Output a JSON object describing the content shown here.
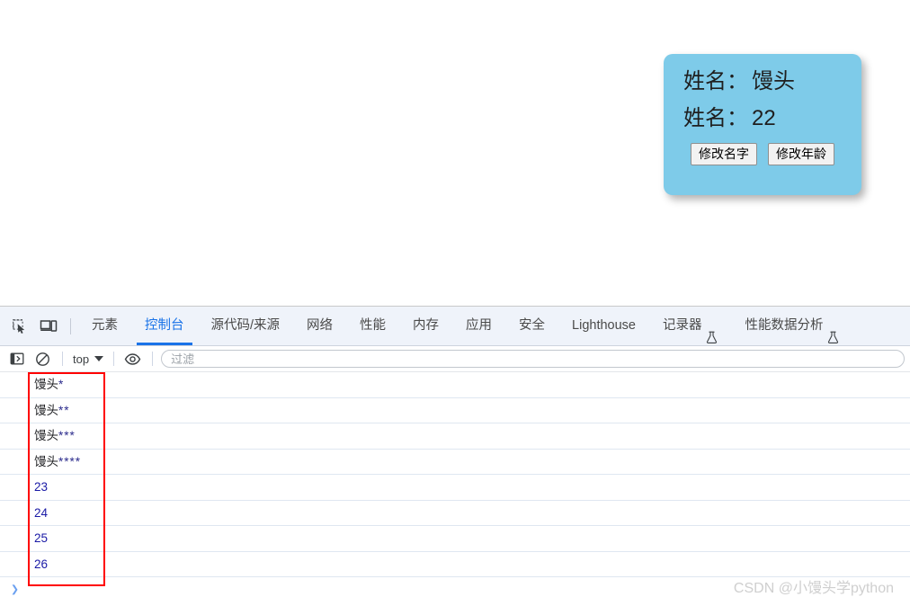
{
  "page": {
    "card": {
      "name_row": {
        "label": "姓名：",
        "value": "馒头"
      },
      "age_row": {
        "label": "姓名：",
        "value": "22"
      },
      "buttons": {
        "change_name": "修改名字",
        "change_age": "修改年龄"
      },
      "background_color": "#7ecbe9"
    }
  },
  "devtools": {
    "toolbar_icons": {
      "inspect": "inspect-element-icon",
      "device": "device-toolbar-icon"
    },
    "tabs": [
      {
        "label": "元素",
        "active": false,
        "experimental": false
      },
      {
        "label": "控制台",
        "active": true,
        "experimental": false
      },
      {
        "label": "源代码/来源",
        "active": false,
        "experimental": false
      },
      {
        "label": "网络",
        "active": false,
        "experimental": false
      },
      {
        "label": "性能",
        "active": false,
        "experimental": false
      },
      {
        "label": "内存",
        "active": false,
        "experimental": false
      },
      {
        "label": "应用",
        "active": false,
        "experimental": false
      },
      {
        "label": "安全",
        "active": false,
        "experimental": false
      },
      {
        "label": "Lighthouse",
        "active": false,
        "experimental": false
      },
      {
        "label": "记录器",
        "active": false,
        "experimental": true
      },
      {
        "label": "性能数据分析",
        "active": false,
        "experimental": true
      }
    ],
    "active_tab_color": "#1a73e8",
    "console_toolbar": {
      "sidebar_toggle": "sidebar-toggle-icon",
      "clear": "clear-console-icon",
      "context": "top",
      "eye": "live-expression-icon",
      "filter_placeholder": "过滤",
      "filter_value": ""
    },
    "console_messages": [
      {
        "text": "馒头",
        "stars": "*",
        "type": "string"
      },
      {
        "text": "馒头",
        "stars": "**",
        "type": "string"
      },
      {
        "text": "馒头",
        "stars": "***",
        "type": "string"
      },
      {
        "text": "馒头",
        "stars": "****",
        "type": "string"
      },
      {
        "text": "23",
        "stars": "",
        "type": "number"
      },
      {
        "text": "24",
        "stars": "",
        "type": "number"
      },
      {
        "text": "25",
        "stars": "",
        "type": "number"
      },
      {
        "text": "26",
        "stars": "",
        "type": "number"
      }
    ],
    "highlight_box_color": "#ff0000",
    "prompt_caret": "❯"
  },
  "watermark": {
    "text": "CSDN @小馒头学python"
  }
}
